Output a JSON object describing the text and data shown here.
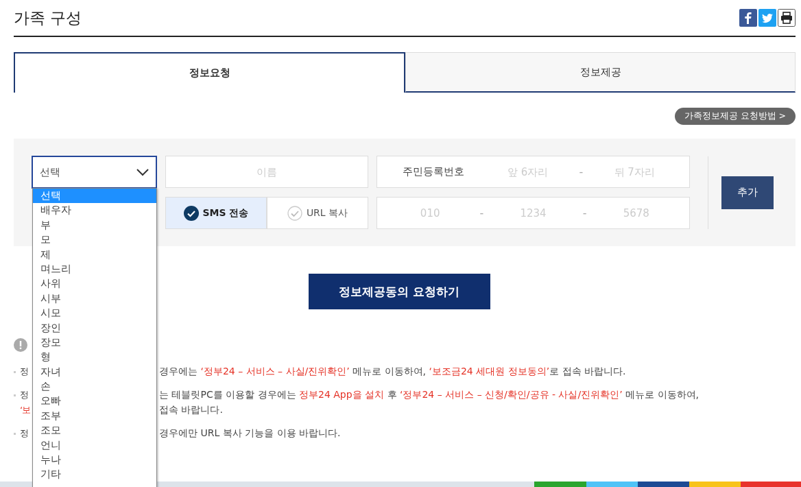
{
  "title": "가족 구성",
  "tabs": [
    {
      "label": "정보요청",
      "selected": true
    },
    {
      "label": "정보제공",
      "selected": false
    }
  ],
  "help_link": "가족정보제공 요청방법 >",
  "form": {
    "relation": {
      "value": "선택"
    },
    "name": {
      "placeholder": "이름"
    },
    "resident": {
      "label": "주민등록번호",
      "front_placeholder": "앞 6자리",
      "separator": "-",
      "back_placeholder": "뒤 7자리"
    },
    "send_methods": [
      {
        "label": "SMS 전송",
        "selected": true
      },
      {
        "label": "URL 복사",
        "selected": false
      }
    ],
    "phone": {
      "placeholders": [
        "010",
        "1234",
        "5678"
      ],
      "separators": [
        "-",
        "-"
      ]
    },
    "add_button": "추가"
  },
  "submit_button": "정보제공동의 요청하기",
  "notices": [
    {
      "lines": [
        {
          "lead": "정",
          "lead_emphasis": false,
          "segments": [
            {
              "text": "경우에는 ",
              "emphasis": false
            },
            {
              "text": "‘정부24 – 서비스 – 사실/진위확인’",
              "emphasis": true
            },
            {
              "text": " 메뉴로 이동하여, ",
              "emphasis": false
            },
            {
              "text": "‘보조금24 세대원 정보동의’",
              "emphasis": true
            },
            {
              "text": "로 접속 바랍니다.",
              "emphasis": false
            }
          ]
        }
      ]
    },
    {
      "lines": [
        {
          "lead": "정",
          "lead_emphasis": false,
          "segments": [
            {
              "text": "는 테블릿PC를 이용할 경우에는 ",
              "emphasis": false
            },
            {
              "text": "정부24 App을 설치",
              "emphasis": true
            },
            {
              "text": " 후 ",
              "emphasis": false
            },
            {
              "text": "‘정부24 – 서비스 – 신청/확인/공유 - 사실/진위확인’",
              "emphasis": true
            },
            {
              "text": " 메뉴로 이동하여,",
              "emphasis": false
            }
          ]
        },
        {
          "lead": "‘보",
          "lead_emphasis": true,
          "segments": [
            {
              "text": "접속 바랍니다.",
              "emphasis": false
            }
          ]
        }
      ]
    },
    {
      "lines": [
        {
          "lead": "정",
          "lead_emphasis": false,
          "segments": [
            {
              "text": "경우에만 URL 복사 기능을 이용 바랍니다.",
              "emphasis": false
            }
          ]
        }
      ]
    }
  ],
  "dropdown": {
    "options": [
      {
        "label": "선택",
        "selected": true
      },
      {
        "label": "배우자",
        "selected": false
      },
      {
        "label": "부",
        "selected": false
      },
      {
        "label": "모",
        "selected": false
      },
      {
        "label": "제",
        "selected": false
      },
      {
        "label": "며느리",
        "selected": false
      },
      {
        "label": "사위",
        "selected": false
      },
      {
        "label": "시부",
        "selected": false
      },
      {
        "label": "시모",
        "selected": false
      },
      {
        "label": "장인",
        "selected": false
      },
      {
        "label": "장모",
        "selected": false
      },
      {
        "label": "형",
        "selected": false
      },
      {
        "label": "자녀",
        "selected": false
      },
      {
        "label": "손",
        "selected": false
      },
      {
        "label": "오빠",
        "selected": false
      },
      {
        "label": "조부",
        "selected": false
      },
      {
        "label": "조모",
        "selected": false
      },
      {
        "label": "언니",
        "selected": false
      },
      {
        "label": "누나",
        "selected": false
      },
      {
        "label": "기타",
        "selected": false
      }
    ]
  }
}
